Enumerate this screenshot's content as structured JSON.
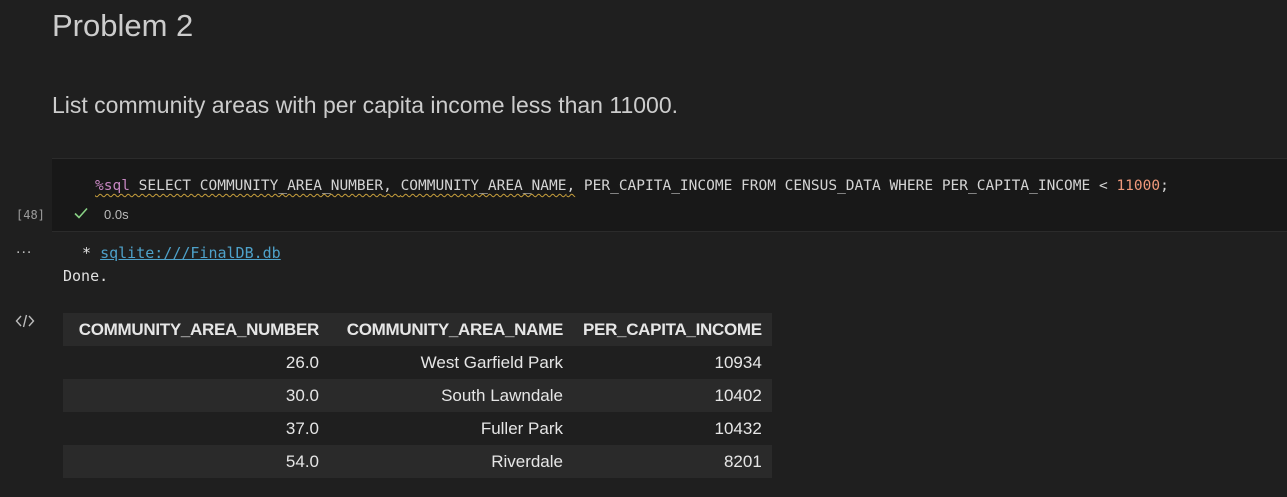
{
  "markdown": {
    "heading": "Problem 2",
    "paragraph": "List community areas with per capita income less than 11000."
  },
  "code_cell": {
    "magic": "%sql",
    "seg_select": " SELECT ",
    "seg_col1": "COMMUNITY_AREA_NUMBER",
    "seg_comma1": ", ",
    "seg_col2": "COMMUNITY_AREA_NAME",
    "seg_comma2": ",",
    "seg_rest": " PER_CAPITA_INCOME FROM CENSUS_DATA WHERE PER_CAPITA_INCOME ",
    "seg_lt": "<",
    "seg_space": " ",
    "seg_num": "11000",
    "seg_semi": ";",
    "execution_count": "[48]",
    "status_time": "0.0s"
  },
  "output": {
    "more_label": "...",
    "connection_prefix": " * ",
    "connection_link": "sqlite:///FinalDB.db",
    "done_text": "Done.",
    "table": {
      "headers": [
        "COMMUNITY_AREA_NUMBER",
        "COMMUNITY_AREA_NAME",
        "PER_CAPITA_INCOME"
      ],
      "rows": [
        [
          "26.0",
          "West Garfield Park",
          "10934"
        ],
        [
          "30.0",
          "South Lawndale",
          "10402"
        ],
        [
          "37.0",
          "Fuller Park",
          "10432"
        ],
        [
          "54.0",
          "Riverdale",
          "8201"
        ]
      ]
    }
  },
  "colors": {
    "background": "#1f1f1f",
    "magic": "#c586c0",
    "number": "#f0997b",
    "link": "#4ea1c9",
    "success_check": "#89d185"
  }
}
